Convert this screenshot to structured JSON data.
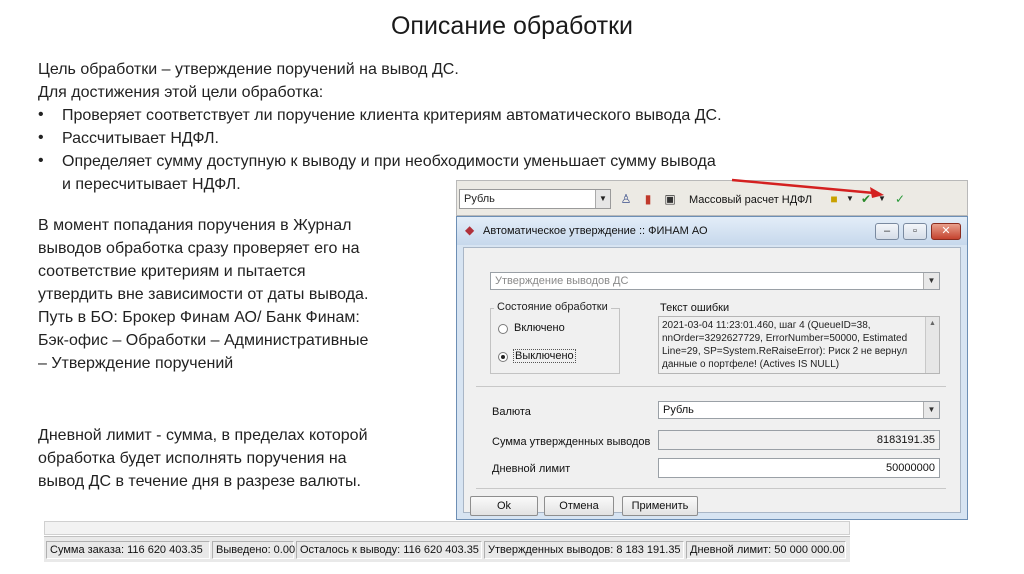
{
  "title": "Описание обработки",
  "intro": {
    "line1": "Цель обработки – утверждение поручений на вывод ДС.",
    "line2": "Для достижения этой цели обработка:",
    "bullet_symbol": "•",
    "bullets": [
      "Проверяет соответствует ли поручение клиента критериям автоматического вывода ДС.",
      "Рассчитывает НДФЛ.",
      "Определяет сумму доступную к выводу и при необходимости уменьшает сумму вывода",
      "и пересчитывает НДФЛ."
    ]
  },
  "paragraph1": [
    "В момент попадания поручения в Журнал",
    "выводов обработка сразу проверяет его на",
    "соответствие критериям и пытается",
    "утвердить вне зависимости от даты вывода.",
    "Путь в БО: Брокер Финам АО/ Банк Финам:",
    "Бэк-офис – Обработки – Административные",
    "– Утверждение поручений"
  ],
  "paragraph2": [
    "Дневной лимит - сумма, в пределах которой",
    "обработка будет исполнять поручения на",
    "вывод ДС в течение дня в разрезе валюты."
  ],
  "toolbar": {
    "currency": "Рубль",
    "label": "Массовый расчет НДФЛ",
    "arrow_color": "#d42020"
  },
  "dialog": {
    "title": "Автоматическое утверждение :: ФИНАМ АО",
    "processing": "Утверждение выводов ДС",
    "state_group": "Состояние обработки",
    "radio_on": "Включено",
    "radio_off": "Выключено",
    "selected": "Выключено",
    "error_label": "Текст ошибки",
    "error_lines": [
      "2021-03-04 11:23:01.460, шаг 4 (QueueID=38,",
      "nnOrder=3292627729, ErrorNumber=50000, Estimated",
      "Line=29, SP=System.ReRaiseError): Риск 2 не вернул",
      "данные о портфеле! (Actives IS NULL)"
    ],
    "currency_label": "Валюта",
    "currency_value": "Рубль",
    "approved_label": "Сумма утвержденных выводов",
    "approved_value": "8183191.35",
    "limit_label": "Дневной лимит",
    "limit_value": "50000000",
    "ok": "Ok",
    "cancel": "Отмена",
    "apply": "Применить"
  },
  "statusbar": [
    "Сумма заказа: 116 620 403.35",
    "Выведено: 0.00",
    "Осталось к выводу: 116 620 403.35",
    "Утвержденных выводов: 8 183 191.35",
    "Дневной лимит: 50 000 000.00"
  ]
}
